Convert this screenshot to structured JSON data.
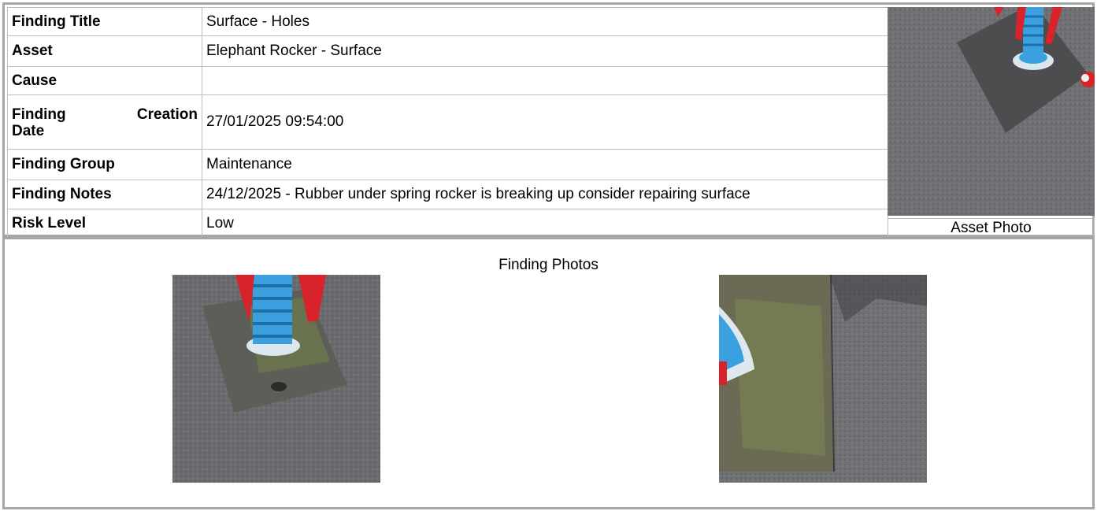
{
  "details": {
    "rows": [
      {
        "label": "Finding Title",
        "value": "Surface - Holes"
      },
      {
        "label": "Asset",
        "value": "Elephant Rocker - Surface"
      },
      {
        "label": "Cause",
        "value": ""
      },
      {
        "label_part1": "Finding",
        "label_part2": "Creation",
        "label_part3": "Date",
        "value": "27/01/2025 09:54:00"
      },
      {
        "label": "Finding Group",
        "value": "Maintenance"
      },
      {
        "label": "Finding Notes",
        "value": "24/12/2025 - Rubber under spring rocker is breaking up consider repairing surface"
      },
      {
        "label": "Risk Level",
        "value": "Low"
      }
    ]
  },
  "asset_photo": {
    "caption": "Asset Photo"
  },
  "finding_photos": {
    "title": "Finding Photos"
  },
  "colors": {
    "border": "#a6a6a6",
    "cell_border": "#bdbdbd",
    "asphalt": "#6f7074",
    "spring_blue": "#3aa0e0",
    "rocker_red": "#d8232a"
  }
}
